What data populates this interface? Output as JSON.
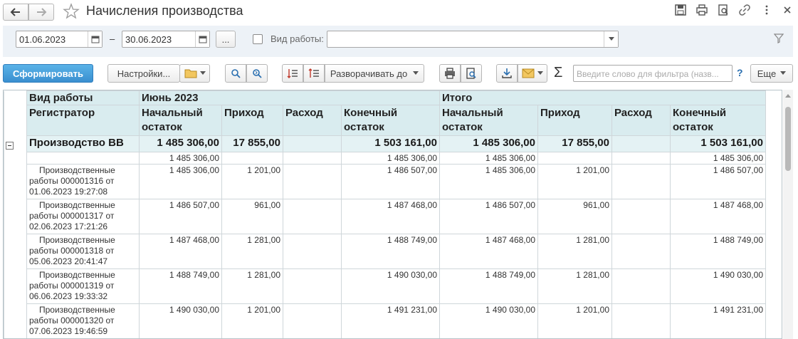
{
  "window": {
    "title": "Начисления производства"
  },
  "icons": {
    "back": "arrow-left-icon",
    "forward": "arrow-right-icon",
    "favorite": "star-icon",
    "save": "floppy-disk-icon",
    "print": "printer-icon",
    "preview": "print-preview-icon",
    "link": "link-icon",
    "more": "more-icon",
    "close": "close-icon",
    "filter": "funnel-icon"
  },
  "filters": {
    "date_from": "01.06.2023",
    "date_sep": "–",
    "date_to": "30.06.2023",
    "period_button": "...",
    "work_type_label": "Вид работы:",
    "work_type_value": ""
  },
  "toolbar": {
    "generate": "Сформировать",
    "settings": "Настройки...",
    "expand_to": "Разворачивать до",
    "search_placeholder": "Введите слово для фильтра (назв...",
    "help": "?",
    "more": "Еще"
  },
  "report": {
    "header": {
      "col1_top": "Вид работы",
      "col1_sub": "Регистратор",
      "group1": "Июнь 2023",
      "group2": "Итого",
      "opening_1": "Начальный",
      "opening_2": "остаток",
      "income": "Приход",
      "expense": "Расход",
      "closing_1": "Конечный",
      "closing_2": "остаток"
    },
    "group_row": {
      "name": "Производство ВВ",
      "june": {
        "opening": "1 485 306,00",
        "income": "17 855,00",
        "expense": "",
        "closing": "1 503 161,00"
      },
      "total": {
        "opening": "1 485 306,00",
        "income": "17 855,00",
        "expense": "",
        "closing": "1 503 161,00"
      }
    },
    "subrow": {
      "june": {
        "opening": "1 485 306,00",
        "closing": "1 485 306,00"
      },
      "total": {
        "opening": "1 485 306,00",
        "closing": "1 485 306,00"
      }
    },
    "rows": [
      {
        "reg_1": "Производственные",
        "reg_2": "работы 000001316 от",
        "reg_3": "01.06.2023 19:27:08",
        "j_open": "1 485 306,00",
        "j_in": "1 201,00",
        "j_out": "",
        "j_close": "1 486 507,00",
        "t_open": "1 485 306,00",
        "t_in": "1 201,00",
        "t_out": "",
        "t_close": "1 486 507,00"
      },
      {
        "reg_1": "Производственные",
        "reg_2": "работы 000001317 от",
        "reg_3": "02.06.2023 17:21:26",
        "j_open": "1 486 507,00",
        "j_in": "961,00",
        "j_out": "",
        "j_close": "1 487 468,00",
        "t_open": "1 486 507,00",
        "t_in": "961,00",
        "t_out": "",
        "t_close": "1 487 468,00"
      },
      {
        "reg_1": "Производственные",
        "reg_2": "работы 000001318 от",
        "reg_3": "05.06.2023 20:41:47",
        "j_open": "1 487 468,00",
        "j_in": "1 281,00",
        "j_out": "",
        "j_close": "1 488 749,00",
        "t_open": "1 487 468,00",
        "t_in": "1 281,00",
        "t_out": "",
        "t_close": "1 488 749,00"
      },
      {
        "reg_1": "Производственные",
        "reg_2": "работы 000001319 от",
        "reg_3": "06.06.2023 19:33:32",
        "j_open": "1 488 749,00",
        "j_in": "1 281,00",
        "j_out": "",
        "j_close": "1 490 030,00",
        "t_open": "1 488 749,00",
        "t_in": "1 281,00",
        "t_out": "",
        "t_close": "1 490 030,00"
      },
      {
        "reg_1": "Производственные",
        "reg_2": "работы 000001320 от",
        "reg_3": "07.06.2023 19:46:59",
        "j_open": "1 490 030,00",
        "j_in": "1 201,00",
        "j_out": "",
        "j_close": "1 491 231,00",
        "t_open": "1 490 030,00",
        "t_in": "1 201,00",
        "t_out": "",
        "t_close": "1 491 231,00"
      }
    ]
  },
  "colors": {
    "accent": "#3a8fd0",
    "header_bg": "#d9ecef",
    "group_bg": "#e4f2f4"
  }
}
